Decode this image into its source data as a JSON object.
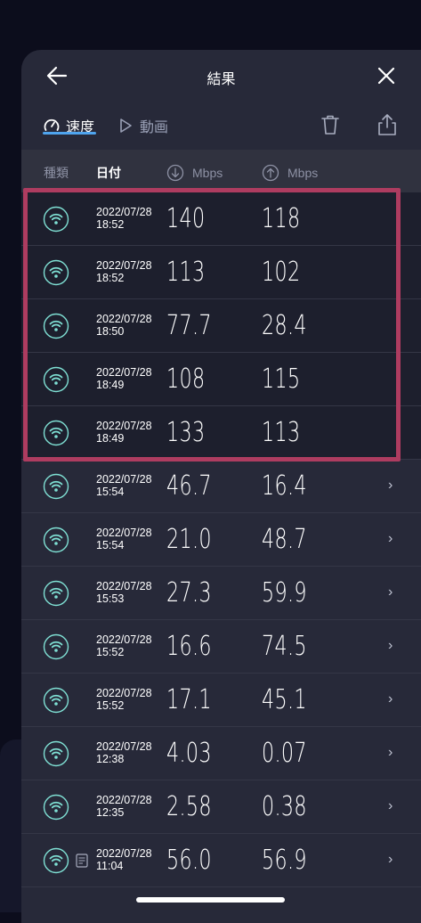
{
  "header": {
    "title": "結果"
  },
  "tabs": [
    {
      "label": "速度",
      "icon": "speedometer-icon",
      "active": true
    },
    {
      "label": "動画",
      "icon": "play-icon",
      "active": false
    }
  ],
  "columns": {
    "type": "種類",
    "date": "日付",
    "down": "Mbps",
    "up": "Mbps"
  },
  "colors": {
    "panel": "#272939",
    "background": "#0c0d1c",
    "accent": "#4fa4ee",
    "wifi": "#7fe0d4",
    "highlight": "#ae3c60"
  },
  "rows": [
    {
      "date": "2022/07/28",
      "time": "18:52",
      "down": "140",
      "up": "118",
      "highlighted": true
    },
    {
      "date": "2022/07/28",
      "time": "18:52",
      "down": "113",
      "up": "102",
      "highlighted": true
    },
    {
      "date": "2022/07/28",
      "time": "18:50",
      "down": "77.7",
      "up": "28.4",
      "highlighted": true
    },
    {
      "date": "2022/07/28",
      "time": "18:49",
      "down": "108",
      "up": "115",
      "highlighted": true
    },
    {
      "date": "2022/07/28",
      "time": "18:49",
      "down": "133",
      "up": "113",
      "highlighted": true
    },
    {
      "date": "2022/07/28",
      "time": "15:54",
      "down": "46.7",
      "up": "16.4",
      "chevron": "›"
    },
    {
      "date": "2022/07/28",
      "time": "15:54",
      "down": "21.0",
      "up": "48.7",
      "chevron": "›"
    },
    {
      "date": "2022/07/28",
      "time": "15:53",
      "down": "27.3",
      "up": "59.9",
      "chevron": "›"
    },
    {
      "date": "2022/07/28",
      "time": "15:52",
      "down": "16.6",
      "up": "74.5",
      "chevron": "›"
    },
    {
      "date": "2022/07/28",
      "time": "15:52",
      "down": "17.1",
      "up": "45.1",
      "chevron": "›"
    },
    {
      "date": "2022/07/28",
      "time": "12:38",
      "down": "4.03",
      "up": "0.07",
      "chevron": "›"
    },
    {
      "date": "2022/07/28",
      "time": "12:35",
      "down": "2.58",
      "up": "0.38",
      "chevron": "›"
    },
    {
      "date": "2022/07/28",
      "time": "11:04",
      "down": "56.0",
      "up": "56.9",
      "chevron": "›",
      "note": true
    }
  ]
}
